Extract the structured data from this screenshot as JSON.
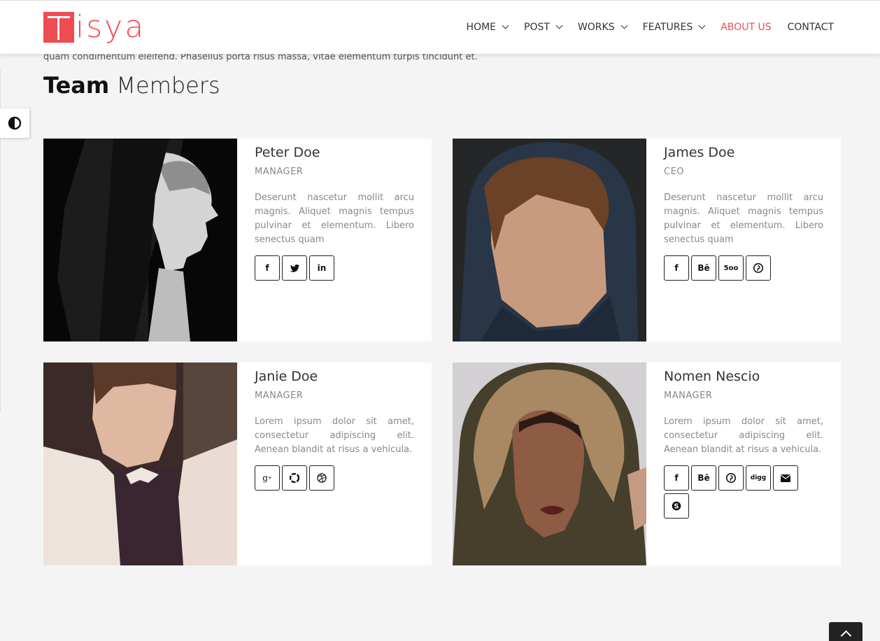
{
  "brand": {
    "logo_text": "isya",
    "accent": "#ef4d52"
  },
  "nav": {
    "items": [
      {
        "label": "HOME",
        "has_dropdown": true,
        "active": false
      },
      {
        "label": "POST",
        "has_dropdown": true,
        "active": false
      },
      {
        "label": "WORKS",
        "has_dropdown": true,
        "active": false
      },
      {
        "label": "FEATURES",
        "has_dropdown": true,
        "active": false
      },
      {
        "label": "ABOUT US",
        "has_dropdown": false,
        "active": true
      },
      {
        "label": "CONTACT",
        "has_dropdown": false,
        "active": false
      }
    ]
  },
  "intro": {
    "text": "quam condimentum eleifend. Phasellus porta risus massa, vitae elementum turpis tincidunt et."
  },
  "section": {
    "title_bold": "Team",
    "title_light": " Members"
  },
  "team": [
    {
      "name": "Peter Doe",
      "role": "MANAGER",
      "bio": "Deserunt nascetur mollit arcu magnis. Aliquet magnis tempus pulvinar et elementum. Libero senectus quam",
      "socials": [
        "facebook-icon",
        "twitter-icon",
        "linkedin-icon"
      ]
    },
    {
      "name": "James Doe",
      "role": "CEO",
      "bio": "Deserunt nascetur mollit arcu magnis. Aliquet magnis tempus pulvinar et elementum. Libero senectus quam",
      "socials": [
        "facebook-icon",
        "behance-icon",
        "500px-icon",
        "pinterest-icon"
      ]
    },
    {
      "name": "Janie Doe",
      "role": "MANAGER",
      "bio": "Lorem ipsum dolor sit amet, consectetur adipiscing elit. Aenean blandit at risus a vehicula.",
      "socials": [
        "google-plus-icon",
        "picasa-icon",
        "dribbble-icon"
      ]
    },
    {
      "name": "Nomen Nescio",
      "role": "MANAGER",
      "bio": "Lorem ipsum dolor sit amet, consectetur adipiscing elit. Aenean blandit at risus a vehicula.",
      "socials": [
        "facebook-icon",
        "behance-icon",
        "pinterest-icon",
        "digg-icon",
        "envelope-icon",
        "skype-icon"
      ]
    }
  ],
  "icons": {
    "contrast": "contrast-icon",
    "scroll_top": "chevron-up-icon"
  }
}
